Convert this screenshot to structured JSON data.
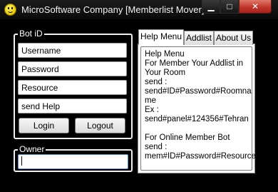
{
  "window": {
    "title": "MicroSoftware Company [Memberlist Mover]",
    "minimize_glyph": "▁",
    "maximize_glyph": "□",
    "close_glyph": "✕"
  },
  "bot_group": {
    "legend": "Bot iD",
    "fields": {
      "username": "Username",
      "password": "Password",
      "resource": "Resource",
      "command": "send Help"
    },
    "login_label": "Login",
    "logout_label": "Logout"
  },
  "owner_group": {
    "legend": "Owner",
    "value": ""
  },
  "tabs": [
    {
      "label": "Help Menu",
      "active": true
    },
    {
      "label": "Addlist",
      "active": false
    },
    {
      "label": "About Us",
      "active": false
    }
  ],
  "help_text": [
    "Help Menu",
    "For Member Your Addlist in",
    "Your Room",
    "send :",
    "send#ID#Password#Roomna",
    "me",
    "Ex :",
    "send#panel#124356#Tehran",
    "",
    "For Online Member Bot",
    "send :",
    "mem#ID#Password#Resource"
  ]
}
